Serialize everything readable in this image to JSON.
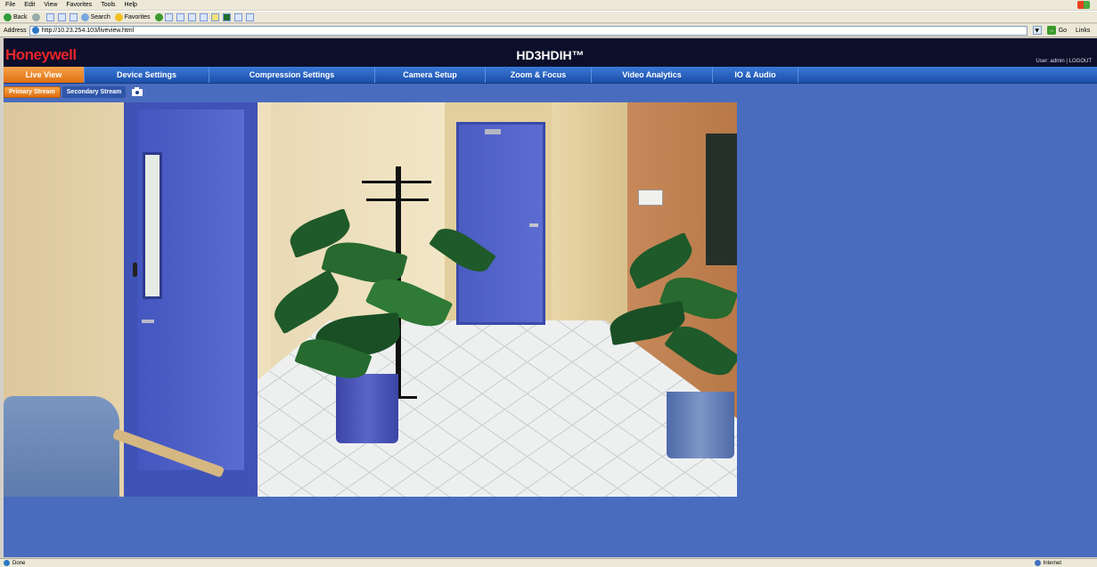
{
  "browser": {
    "menu": [
      "File",
      "Edit",
      "View",
      "Favorites",
      "Tools",
      "Help"
    ],
    "toolbar": {
      "back": "Back",
      "search": "Search",
      "favorites": "Favorites"
    },
    "address_label": "Address",
    "url": "http://10.23.254.103/liveview.html",
    "go": "Go",
    "links": "Links",
    "status": "Done",
    "zone": "Internet"
  },
  "header": {
    "brand": "Honeywell",
    "model": "HD3HDIH™",
    "user_info": "User: admin | LOGOUT"
  },
  "nav": {
    "tabs": [
      {
        "label": "Live View",
        "active": true
      },
      {
        "label": "Device Settings"
      },
      {
        "label": "Compression Settings"
      },
      {
        "label": "Camera Setup"
      },
      {
        "label": "Zoom & Focus"
      },
      {
        "label": "Video Analytics"
      },
      {
        "label": "IO & Audio"
      }
    ]
  },
  "streams": {
    "primary": "Primary Stream",
    "secondary": "Secondary Stream"
  },
  "colors": {
    "page_bg": "#4a6cbe",
    "header_bg": "#0c0f2a",
    "brand_red": "#e8242a",
    "active_tab": "#e06f12",
    "nav_blue": "#2a5fc0"
  }
}
